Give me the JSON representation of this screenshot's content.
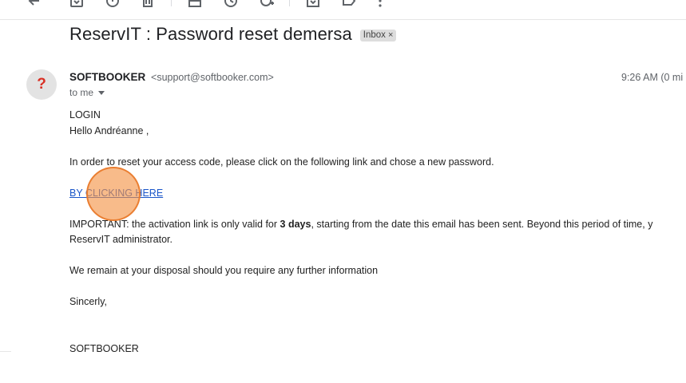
{
  "toolbar": {
    "icons": [
      "back-arrow-icon",
      "archive-icon",
      "report-spam-icon",
      "delete-icon",
      "mark-unread-icon",
      "snooze-icon",
      "add-to-tasks-icon",
      "move-to-icon",
      "labels-icon",
      "more-options-icon"
    ]
  },
  "email": {
    "subject": "ReservIT : Password reset demersa",
    "label": "Inbox",
    "label_remove": "×",
    "sender_name": "SOFTBOOKER",
    "sender_email": "<support@softbooker.com>",
    "timestamp": "9:26 AM (0 mi",
    "recipient": "to me",
    "avatar_glyph": "?",
    "body": {
      "line_login": "LOGIN",
      "line_hello": "Hello Andréanne ,",
      "line_instruction": "In order to reset your access code, please click on the following link and chose a new password.",
      "link_text": "BY CLICKING HERE",
      "important_prefix": "IMPORTANT: the activation link is only valid for ",
      "important_bold": "3 days",
      "important_suffix": ", starting from the date this email has been sent. Beyond this period of time, y",
      "important_line2": "ReservIT administrator.",
      "line_disposal": "We remain at your disposal should you require any further information",
      "line_sincerely": "Sincerly,",
      "line_signature": "SOFTBOOKER"
    }
  },
  "colors": {
    "link": "#1a56c9",
    "click_marker": "#f49242",
    "avatar_question": "#d93025"
  }
}
